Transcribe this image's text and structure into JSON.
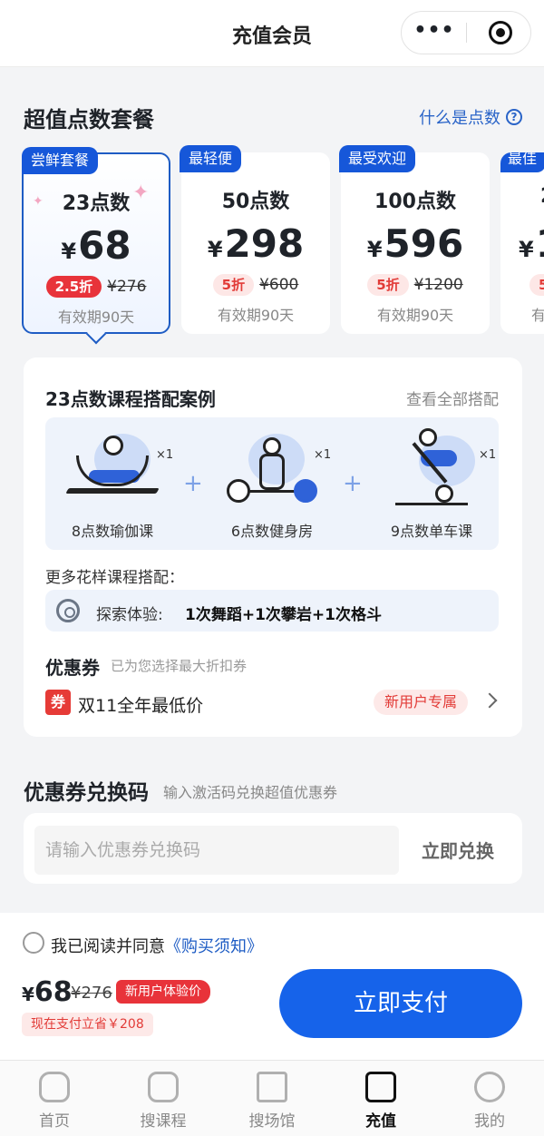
{
  "nav": {
    "title": "充值会员",
    "more": "•••"
  },
  "section": {
    "title": "超值点数套餐",
    "help": "什么是点数",
    "help_icon": "?"
  },
  "packages": [
    {
      "tag": "尝鲜套餐",
      "points": "23点数",
      "yen": "¥",
      "price": "68",
      "discount": "2.5折",
      "original": "¥276",
      "validity": "有效期90天",
      "selected": true
    },
    {
      "tag": "最轻便",
      "points": "50点数",
      "yen": "¥",
      "price": "298",
      "discount": "5折",
      "original": "¥600",
      "validity": "有效期90天",
      "selected": false
    },
    {
      "tag": "最受欢迎",
      "points": "100点数",
      "yen": "¥",
      "price": "596",
      "discount": "5折",
      "original": "¥1200",
      "validity": "有效期90天",
      "selected": false
    },
    {
      "tag": "最佳",
      "points": "2",
      "yen": "¥",
      "price": "1",
      "discount": "5.",
      "original": "",
      "validity": "有",
      "selected": false
    }
  ],
  "example": {
    "title": "23点数课程搭配案例",
    "view_all": "查看全部搭配",
    "courses": [
      {
        "caption": "8点数瑜伽课",
        "times": "×1",
        "icon": "yoga-icon"
      },
      {
        "caption": "6点数健身房",
        "times": "×1",
        "icon": "weightlifting-icon"
      },
      {
        "caption": "9点数单车课",
        "times": "×1",
        "icon": "cycling-icon"
      }
    ],
    "plus": "+",
    "more_title": "更多花样课程搭配：",
    "explore_label": "探索体验:",
    "explore_value": "1次舞蹈+1次攀岩+1次格斗"
  },
  "coupon": {
    "title": "优惠券",
    "subtitle": "已为您选择最大折扣券",
    "badge": "券",
    "text": "双11全年最低价",
    "tag": "新用户专属"
  },
  "redeem": {
    "title": "优惠券兑换码",
    "subtitle": "输入激活码兑换超值优惠券",
    "placeholder": "请输入优惠券兑换码",
    "button": "立即兑换"
  },
  "checkout": {
    "agree_text": "我已阅读并同意",
    "agree_link": "《购买须知》",
    "yen": "¥",
    "price": "68",
    "original": "¥276",
    "tag": "新用户体验价",
    "save": "现在支付立省￥208",
    "pay_button": "立即支付"
  },
  "tabs": [
    {
      "label": "首页",
      "icon": "home-icon"
    },
    {
      "label": "搜课程",
      "icon": "course-icon"
    },
    {
      "label": "搜场馆",
      "icon": "venue-icon"
    },
    {
      "label": "充值",
      "icon": "wallet-icon",
      "active": true
    },
    {
      "label": "我的",
      "icon": "profile-icon"
    }
  ],
  "colors": {
    "accent": "#1663ea",
    "red": "#e8333a",
    "link": "#2a64c8"
  }
}
